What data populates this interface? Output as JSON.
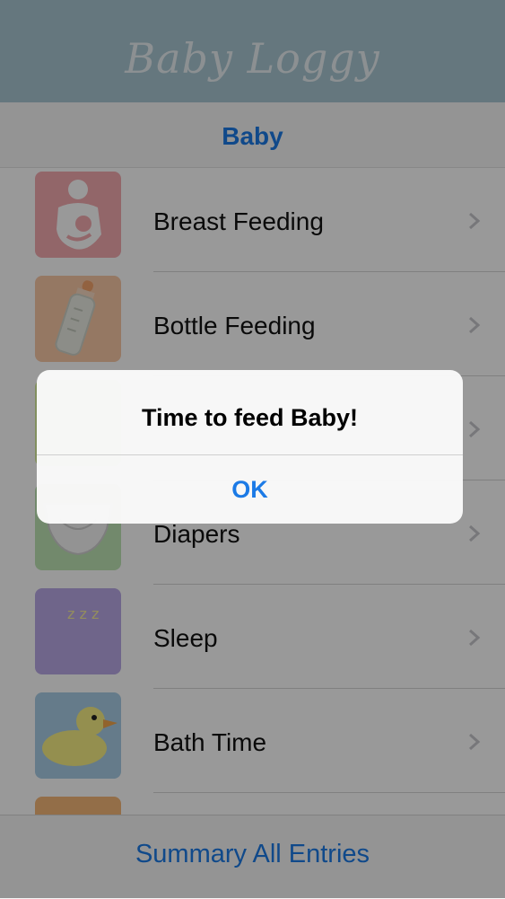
{
  "header": {
    "title": "Baby Loggy"
  },
  "segment": {
    "label": "Baby"
  },
  "list": {
    "items": [
      {
        "label": "Breast Feeding",
        "icon": "breastfeeding-icon",
        "tile_color": "#f4aab0"
      },
      {
        "label": "Bottle Feeding",
        "icon": "bottle-icon",
        "tile_color": "#f9c9a6"
      },
      {
        "label": "",
        "icon": "hidden-category-icon",
        "tile_color": "#d9ef9f"
      },
      {
        "label": "Diapers",
        "icon": "diaper-icon",
        "tile_color": "#bfe5b5"
      },
      {
        "label": "Sleep",
        "icon": "moon-sleep-icon",
        "tile_color": "#b9a8e6"
      },
      {
        "label": "Bath Time",
        "icon": "rubber-duck-icon",
        "tile_color": "#a9cde6"
      },
      {
        "label": "",
        "icon": "partial-item-icon",
        "tile_color": "#f6b779"
      }
    ]
  },
  "footer": {
    "label": "Summary All Entries"
  },
  "alert": {
    "title": "Time to feed Baby!",
    "button_label": "OK"
  },
  "colors": {
    "accent": "#1b7ae6",
    "header_bg": "#a8c6d3"
  }
}
